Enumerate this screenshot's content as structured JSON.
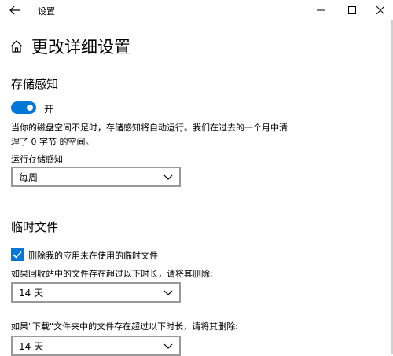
{
  "titlebar": {
    "app_title": "设置",
    "back_icon": "arrow-left-icon",
    "minimize_icon": "minimize-icon",
    "maximize_icon": "maximize-icon",
    "close_icon": "close-icon"
  },
  "header": {
    "home_icon": "home-icon",
    "title": "更改详细设置"
  },
  "storage_sense": {
    "heading": "存储感知",
    "toggle_state": "on",
    "toggle_label": "开",
    "description": "当你的磁盘空间不足时，存储感知将自动运行。我们在过去的一个月中清理了 0 字节 的空间。",
    "run_label": "运行存储感知",
    "run_value": "每周"
  },
  "temp_files": {
    "heading": "临时文件",
    "checkbox_label": "删除我的应用未在使用的临时文件",
    "checkbox_checked": true,
    "recycle_label": "如果回收站中的文件存在超过以下时长，请将其删除:",
    "recycle_value": "14 天",
    "downloads_label": "如果\"下载\"文件夹中的文件存在超过以下时长，请将其删除:",
    "downloads_value": "14 天"
  },
  "colors": {
    "accent": "#0078d7",
    "border": "#999999"
  }
}
